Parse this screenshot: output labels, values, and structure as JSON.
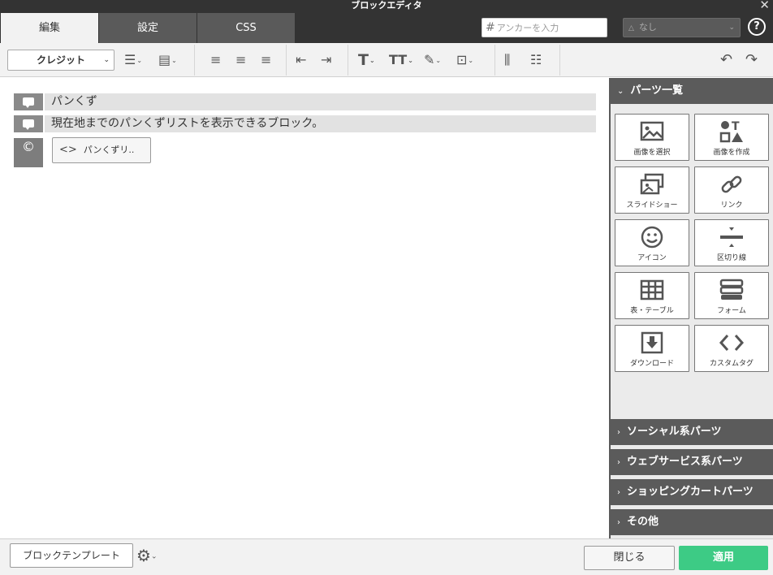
{
  "window": {
    "title": "ブロックエディタ",
    "close_glyph": "✕"
  },
  "tabs": [
    {
      "label": "編集",
      "active": true
    },
    {
      "label": "設定",
      "active": false
    },
    {
      "label": "CSS",
      "active": false
    }
  ],
  "anchor": {
    "placeholder": "アンカーを入力"
  },
  "class_select": {
    "value": "なし"
  },
  "help_label": "?",
  "toolbar": {
    "block_type_value": "クレジット"
  },
  "editor": {
    "blocks": [
      {
        "text": "パンくず"
      },
      {
        "text": "現在地までのパンくずリストを表示できるブロック。"
      }
    ],
    "copyright_glyph": "©",
    "custom_tag_button": "パンくずリ.."
  },
  "panel": {
    "parts_header": "パーツ一覧",
    "tiles": [
      {
        "label": "画像を選択",
        "icon": "image-icon"
      },
      {
        "label": "画像を作成",
        "icon": "shapes-icon"
      },
      {
        "label": "スライドショー",
        "icon": "slideshow-icon"
      },
      {
        "label": "リンク",
        "icon": "link-icon"
      },
      {
        "label": "アイコン",
        "icon": "smiley-icon"
      },
      {
        "label": "区切り線",
        "icon": "divider-icon"
      },
      {
        "label": "表・テーブル",
        "icon": "table-icon"
      },
      {
        "label": "フォーム",
        "icon": "form-icon"
      },
      {
        "label": "ダウンロード",
        "icon": "download-icon"
      },
      {
        "label": "カスタムタグ",
        "icon": "code-icon"
      }
    ],
    "sections": [
      {
        "label": "ソーシャル系パーツ"
      },
      {
        "label": "ウェブサービス系パーツ"
      },
      {
        "label": "ショッピングカートパーツ"
      },
      {
        "label": "その他"
      }
    ]
  },
  "footer": {
    "template_button": "ブロックテンプレート",
    "close_button": "閉じる",
    "apply_button": "適用"
  },
  "colors": {
    "apply": "#3dcb85",
    "header_dark": "#333333",
    "panel_header": "#5b5b5b"
  }
}
